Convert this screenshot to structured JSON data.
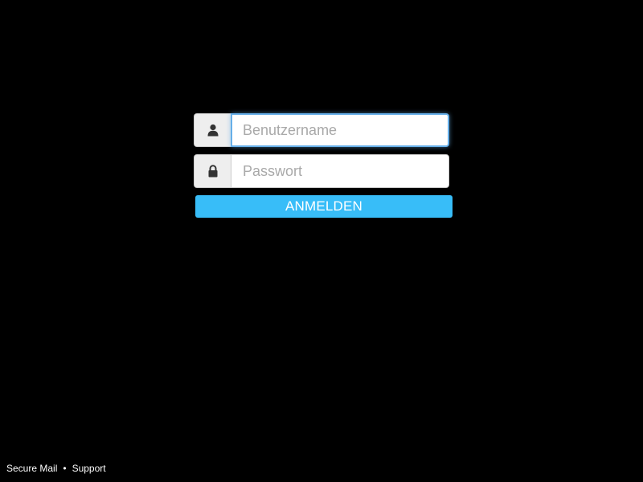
{
  "login": {
    "username": {
      "icon": "user-icon",
      "placeholder": "Benutzername",
      "value": ""
    },
    "password": {
      "icon": "lock-icon",
      "placeholder": "Passwort",
      "value": ""
    },
    "submit_label": "ANMELDEN"
  },
  "footer": {
    "links": [
      "Secure Mail",
      "Support"
    ],
    "separator": "•"
  },
  "colors": {
    "background": "#000000",
    "button": "#38bdf8",
    "focus_border": "#66afe9",
    "icon": "#333333"
  }
}
